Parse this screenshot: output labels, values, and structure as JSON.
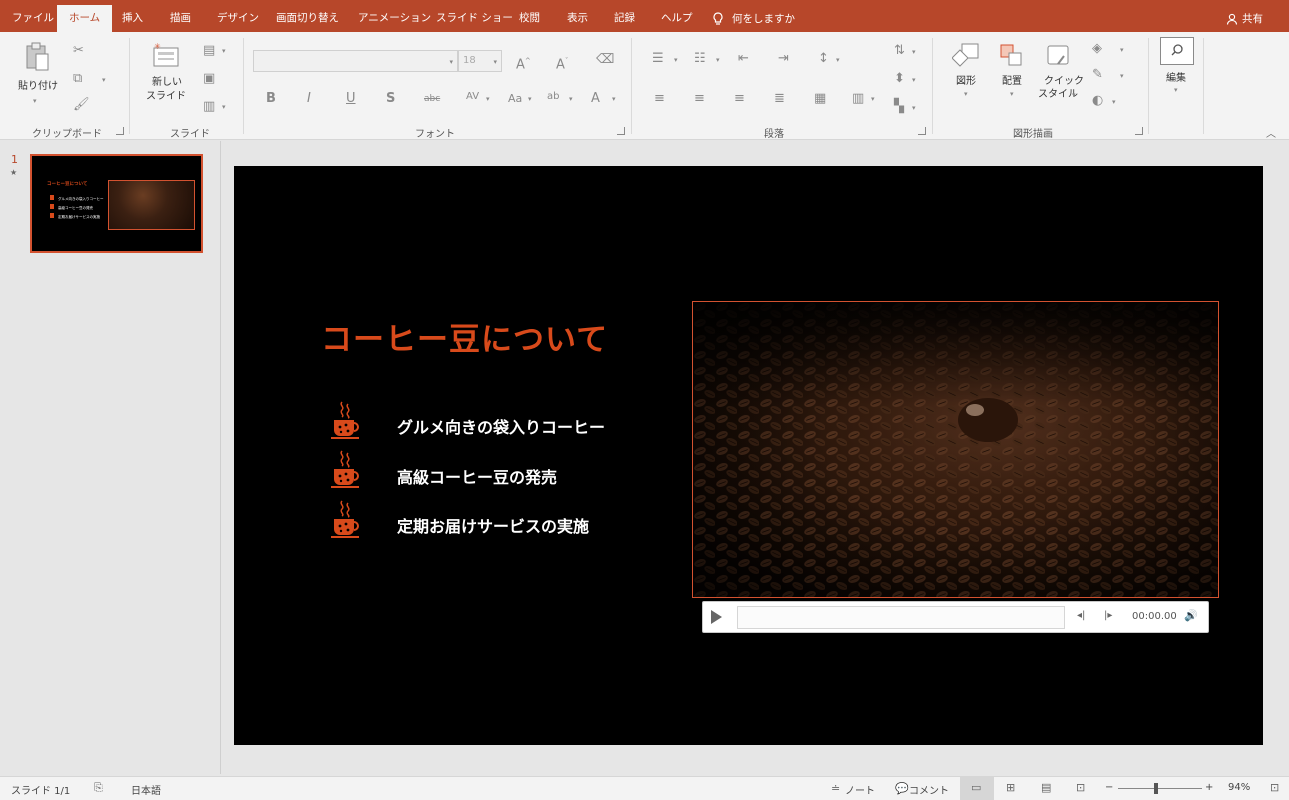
{
  "tabs": {
    "file": "ファイル",
    "home": "ホーム",
    "insert": "挿入",
    "draw": "描画",
    "design": "デザイン",
    "transitions": "画面切り替え",
    "animations": "アニメーション",
    "slideshow": "スライド ショー",
    "review": "校閲",
    "view": "表示",
    "record": "記録",
    "help": "ヘルプ",
    "tell_me": "何をしますか",
    "share": "共有"
  },
  "ribbon": {
    "paste_label": "貼り付け",
    "new_slide_line1": "新しい",
    "new_slide_line2": "スライド",
    "font_size": "18",
    "arrange_label": "配置",
    "shapes_label": "図形",
    "quick_styles_line1": "クイック",
    "quick_styles_line2": "スタイル",
    "editing_label": "編集",
    "groups": {
      "clipboard": "クリップボード",
      "slides": "スライド",
      "font": "フォント",
      "paragraph": "段落",
      "drawing": "図形描画"
    }
  },
  "thumbnails": {
    "slide_number": "1",
    "thumb_title": "コーヒー豆について",
    "thumb_bullets": [
      "グルメ向きの袋入りコーヒー",
      "高級コーヒー豆の発売",
      "定期お届けサービスの実施"
    ]
  },
  "slide": {
    "title": "コーヒー豆について",
    "bullets": [
      "グルメ向きの袋入りコーヒー",
      "高級コーヒー豆の発売",
      "定期お届けサービスの実施"
    ],
    "title_color": "#d84a1b"
  },
  "media": {
    "time": "00:00.00"
  },
  "statusbar": {
    "slide_info": "スライド 1/1",
    "language": "日本語",
    "notes": "ノート",
    "comments": "コメント",
    "zoom": "94%"
  },
  "colors": {
    "accent": "#b7472a",
    "ribbon_bg": "#f3f3f3",
    "slide_bg": "#000000"
  }
}
